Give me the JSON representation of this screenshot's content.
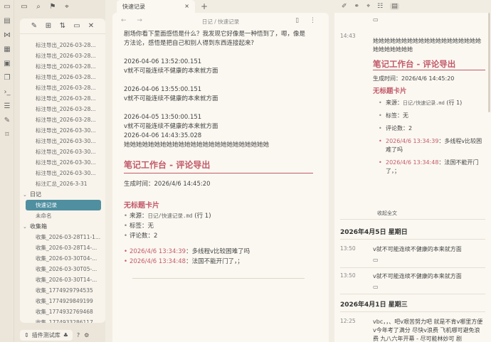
{
  "ribbon": {
    "icons": [
      "files-icon",
      "graph-icon",
      "blocks-icon",
      "calendar-icon",
      "copy-icon",
      "terminal-icon",
      "list-icon",
      "pen-icon",
      "bookmark-icon"
    ]
  },
  "sidebar": {
    "tree": [
      {
        "kind": "item",
        "label": "标注导出_2026-03-28..."
      },
      {
        "kind": "item",
        "label": "标注导出_2026-03-28..."
      },
      {
        "kind": "item",
        "label": "标注导出_2026-03-28..."
      },
      {
        "kind": "item",
        "label": "标注导出_2026-03-28..."
      },
      {
        "kind": "item",
        "label": "标注导出_2026-03-28..."
      },
      {
        "kind": "item",
        "label": "标注导出_2026-03-28..."
      },
      {
        "kind": "item",
        "label": "标注导出_2026-03-28..."
      },
      {
        "kind": "item",
        "label": "标注导出_2026-03-28..."
      },
      {
        "kind": "item",
        "label": "标注导出_2026-03-30..."
      },
      {
        "kind": "item",
        "label": "标注导出_2026-03-30..."
      },
      {
        "kind": "item",
        "label": "标注导出_2026-03-30..."
      },
      {
        "kind": "item",
        "label": "标注导出_2026-03-30..."
      },
      {
        "kind": "item",
        "label": "标注导出_2026-03-30..."
      },
      {
        "kind": "item",
        "label": "标注汇总_2026-3-31"
      },
      {
        "kind": "folder",
        "label": "日记"
      },
      {
        "kind": "item",
        "label": "快速记录",
        "active": true
      },
      {
        "kind": "item",
        "label": "未命名"
      },
      {
        "kind": "folder",
        "label": "收集箱"
      },
      {
        "kind": "item",
        "label": "收集_2026-03-28T11-1..."
      },
      {
        "kind": "item",
        "label": "收集_2026-03-28T14-..."
      },
      {
        "kind": "item",
        "label": "收集_2026-03-30T04-..."
      },
      {
        "kind": "item",
        "label": "收集_2026-03-30T05-..."
      },
      {
        "kind": "item",
        "label": "收集_2026-03-30T14-..."
      },
      {
        "kind": "item",
        "label": "收集_1774929794535"
      },
      {
        "kind": "item",
        "label": "收集_1774929849199"
      },
      {
        "kind": "item",
        "label": "收集_1774932769468"
      },
      {
        "kind": "item",
        "label": "收集_1774933286117"
      }
    ],
    "vault_name": "插件测试库"
  },
  "tabs": {
    "active_label": "快速记录",
    "close_glyph": "×",
    "add_glyph": "+"
  },
  "main": {
    "breadcrumb": "日记 / 快速记录",
    "lines": {
      "l1": "剧场你看下里面感悟是什么？我发现它好像是一种悟到了，嗯，像是",
      "l2": "方法论，感悟是把自己和别人得到东西连接起来?",
      "l3": "2026-04-06 13:52:00.151",
      "l4": "v就不可能连续不健康的本来就方面",
      "l5": "2026-04-06 13:55:00.151",
      "l6": "v就不可能连续不健康的本来就方面",
      "l7": "2026-04-05 13:50:00.151",
      "l8": "v就不可能连续不健康的本来就方面",
      "l9": "2026-04-06 14:43:35.028",
      "l10": "她她她她她她她她她她她她她她她她她她她她她她她她"
    },
    "h2": "笔记工作台 - 评论导出",
    "generated": "生成时间：2026/4/6 14:45:20",
    "h3": "无标题卡片",
    "source_prefix": "来源：",
    "source_path": "日记/快速记录.md",
    "source_suffix": "(行 1)",
    "tags": "标签：无",
    "comment_count": "评论数：2",
    "c1_ts": "2026/4/6 13:34:39",
    "c1_text": "：多线程v比较困难了吗",
    "c2_ts": "2026/4/6 13:34:48",
    "c2_text": "：法国不能开门了，；"
  },
  "right": {
    "r1_count": "",
    "r2_time": "14:43",
    "r2_text": "她她她她她她她她她她她她她她她她她她她她她她她她她她",
    "r2_h2": "笔记工作台 - 评论导出",
    "r2_generated": "生成时间：2026/4/6 14:45:20",
    "r2_h3": "无标题卡片",
    "r2_source_prefix": "来源：",
    "r2_source_path": "日记/快速记录.md",
    "r2_source_suffix": "(行 1)",
    "r2_tags": "标签：无",
    "r2_count": "评论数：2",
    "r2_c1_ts": "2026/4/6 13:34:39",
    "r2_c1_text": "：多线程v比较困难了吗",
    "r2_c2_ts": "2026/4/6 13:34:48",
    "r2_c2_text": "：法国不能开门了，；",
    "expand": "收起全文",
    "date1": "2026年4月5日 星期日",
    "e1_time": "13:50",
    "e1_text": "v就不可能连续不健康的本来就方面",
    "e2_time": "13:50",
    "e2_text": "v就不可能连续不健康的本来就方面",
    "date2": "2026年4月1日 星期三",
    "e3_time": "12:25",
    "e3_text": "vbc，，、吧v艰苦努力吧 就是不肯v哪里方便v今年考了满分 尽快v浪费 飞机哪可避免浪费 九八六年开幕 - 尽可能林妙可 剧"
  }
}
